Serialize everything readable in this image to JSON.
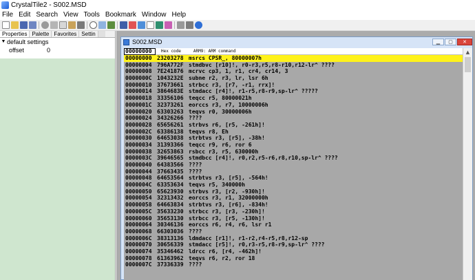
{
  "window": {
    "title": "CrystalTile2 - S002.MSD"
  },
  "menu": [
    "File",
    "Edit",
    "Search",
    "View",
    "Tools",
    "Bookmark",
    "Window",
    "Help"
  ],
  "left_panel": {
    "tabs": [
      "Properties",
      "Palette",
      "Favorites",
      "Settin"
    ],
    "tree": {
      "group_label": "default settings",
      "prop_label": "offset",
      "prop_value": "0"
    }
  },
  "child_window": {
    "title": "S002.MSD",
    "address_box": "00000000",
    "header_hex": "Hex code",
    "header_arm": "ARM9: ARM command",
    "rows": [
      [
        "00000000",
        "23203278",
        "msrcs CPSR_, 80000007h"
      ],
      [
        "00000004",
        "796A772F",
        "stmdbvc [r10]!, r0-r3,r5,r8-r10,r12-lr^ ????"
      ],
      [
        "00000008",
        "7E241876",
        "mcrvc cp3, 1, r1, cr4, cr14, 3"
      ],
      [
        "0000000C",
        "1043232E",
        "subne r2, r3, lr, lsr 6h"
      ],
      [
        "00000010",
        "37673661",
        "strbcc r3, [r7, -r1, rrx]!"
      ],
      [
        "00000014",
        "3864683E",
        "stmdacc [r4]!, r1-r5,r8-r9,sp-lr^ ?????"
      ],
      [
        "00000018",
        "33356106",
        "teqcc r5, 80000021h"
      ],
      [
        "0000001C",
        "32373261",
        "eorccs r3, r7, 10000006h"
      ],
      [
        "00000020",
        "63303263",
        "teqvs r0, 30000006h"
      ],
      [
        "00000024",
        "34326266",
        "????"
      ],
      [
        "00000028",
        "65656261",
        "strbvs r6, [r5, -261h]!"
      ],
      [
        "0000002C",
        "63386138",
        "teqvs r8, Eh"
      ],
      [
        "00000030",
        "64653038",
        "strbtvs r3, [r5], -38h!"
      ],
      [
        "00000034",
        "31393366",
        "teqcc r9, r6, ror 6"
      ],
      [
        "00000038",
        "32653863",
        "rsbcc r3, r5, 630000h"
      ],
      [
        "0000003C",
        "39646565",
        "stmdbcc [r4]!, r0,r2,r5-r6,r8,r10,sp-lr^ ????"
      ],
      [
        "00000040",
        "64383566",
        "????"
      ],
      [
        "00000044",
        "37663435",
        "????"
      ],
      [
        "00000048",
        "64653564",
        "strbtvs r3, [r5], -564h!"
      ],
      [
        "0000004C",
        "63353634",
        "teqvs r5, 340000h"
      ],
      [
        "00000050",
        "65623930",
        "strbvs r3, [r2, -930h]!"
      ],
      [
        "00000054",
        "32313432",
        "eorccs r3, r1, 32000000h"
      ],
      [
        "00000058",
        "64663834",
        "strbtvs r3, [r6], -834h!"
      ],
      [
        "0000005C",
        "35633230",
        "strbcc r3, [r3, -230h]!"
      ],
      [
        "00000060",
        "35653130",
        "strbcc r3, [r5, -130h]!"
      ],
      [
        "00000064",
        "30346136",
        "eorccs r6, r4, r6, lsr r1"
      ],
      [
        "00000068",
        "66303036",
        "????"
      ],
      [
        "0000006C",
        "38313136",
        "ldmdacc [r1]!, r1-r2,r4-r5,r8,r12-sp"
      ],
      [
        "00000070",
        "30656339",
        "stmdacc [r5]!, r0,r3-r5,r8-r9,sp-lr^ ????"
      ],
      [
        "00000074",
        "35346462",
        "ldrcc r6, [r4, -462h]!"
      ],
      [
        "00000078",
        "61363962",
        "teqvs r6, r2, ror 18"
      ],
      [
        "0000007C",
        "37336339",
        "????"
      ]
    ]
  },
  "colors": {
    "selection": "#fff21a",
    "left_panel_bg": "#cfe6cf",
    "code_bg": "#a8a8a8"
  },
  "icons": [
    "app-icon",
    "new-icon",
    "open-icon",
    "save-icon",
    "undo-icon",
    "cut-icon",
    "copy-icon",
    "paste-icon",
    "delete-icon",
    "search-icon",
    "tile-icon",
    "grid-icon",
    "help-icon"
  ]
}
